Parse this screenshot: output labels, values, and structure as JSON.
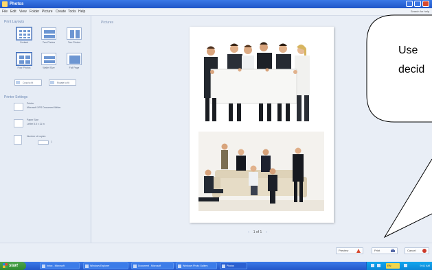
{
  "window": {
    "title": "Photos"
  },
  "menu": {
    "items": [
      "File",
      "Edit",
      "View",
      "Folder",
      "Picture",
      "Create",
      "Tools",
      "Help"
    ],
    "help_text": "Search for help"
  },
  "left_panel": {
    "print_layouts_title": "Print Layouts",
    "layouts": [
      "Contact",
      "Two Photos",
      "Two Photos",
      "Four Photos",
      "Wallet Size",
      "Full Page"
    ],
    "options": [
      "Crop to fit",
      "Rotate to fit"
    ],
    "printer_settings_title": "Printer Settings",
    "printer": {
      "label": "Printer",
      "value": "Microsoft XPS Document Writer"
    },
    "paper": {
      "label": "Paper Size",
      "value": "Letter 8.5 x 11 in"
    },
    "copies": {
      "label": "Number of copies",
      "value": "1"
    }
  },
  "main": {
    "pictures_label": "Pictures"
  },
  "pager": {
    "current": "1 of 1",
    "prev_icon": "arrow-left-icon",
    "next_icon": "arrow-right-icon"
  },
  "callout": {
    "line1": "Use",
    "line2": "decid"
  },
  "bottom_buttons": [
    {
      "label": "Preview",
      "icon": "warning-icon",
      "color": "#d84a30"
    },
    {
      "label": "Print",
      "icon": "printer-icon",
      "color": "#566aa8"
    },
    {
      "label": "Cancel",
      "icon": "close-icon",
      "color": "#cc3a2a"
    }
  ],
  "taskbar": {
    "start_label": "start",
    "items": [
      "Inbox - Microsoft",
      "Windows Explorer",
      "Document - Microsoft",
      "Windows Photo Gallery",
      "Photos"
    ],
    "tray_lang": "EN",
    "clock": "9:41 AM"
  },
  "colors": {
    "accent": "#2a5fd0",
    "panel": "#e6ecf5"
  }
}
